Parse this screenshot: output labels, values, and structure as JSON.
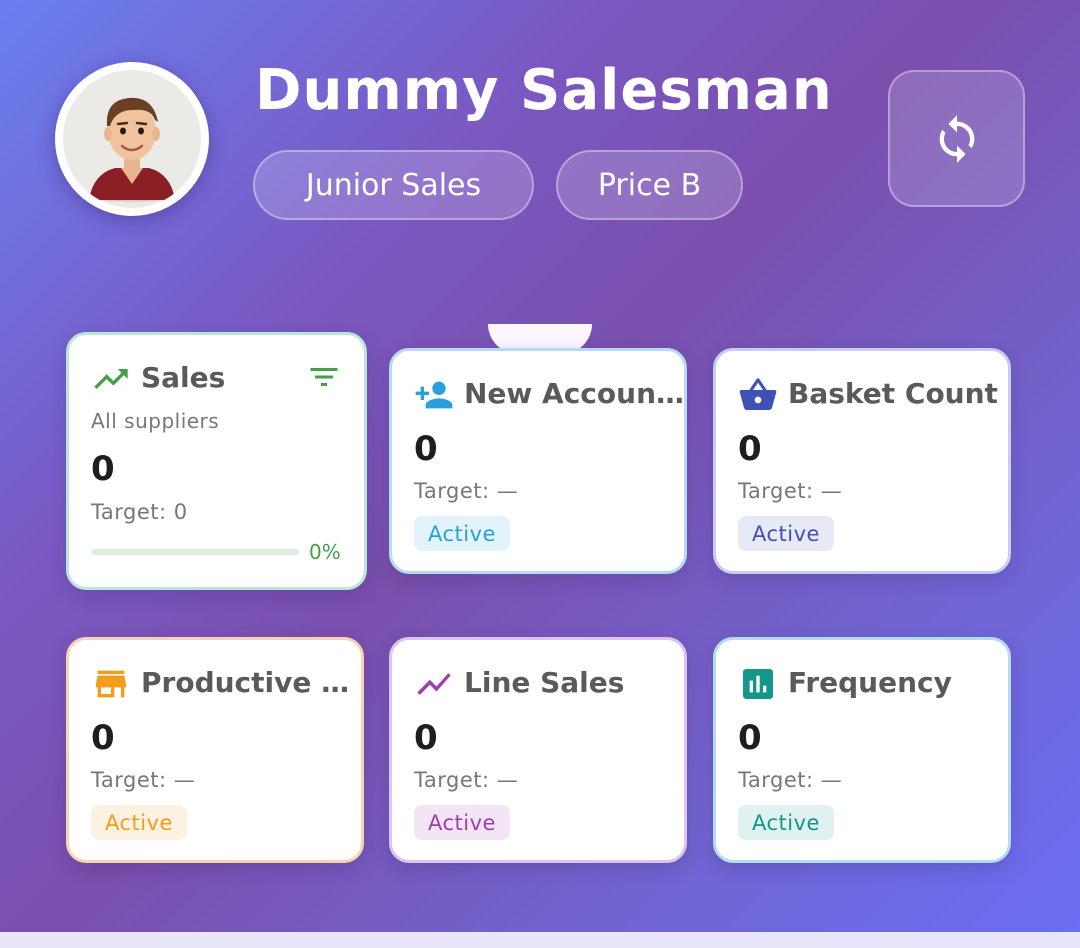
{
  "profile": {
    "name": "Dummy  Salesman",
    "role": "Junior Sales",
    "price_group": "Price B"
  },
  "header": {
    "refresh_icon": "refresh-icon"
  },
  "cards": [
    {
      "title": "Sales",
      "icon": "trending-up-icon",
      "subtitle": "All suppliers",
      "value": "0",
      "target": "Target: 0",
      "progress_label": "0%",
      "progress": 0,
      "accent": "#43a047"
    },
    {
      "title": "New Accoun…",
      "icon": "person-add-icon",
      "value": "0",
      "target": "Target: —",
      "status": "Active",
      "accent": "#29a0dc"
    },
    {
      "title": "Basket Count",
      "icon": "basket-icon",
      "value": "0",
      "target": "Target: —",
      "status": "Active",
      "accent": "#3f51b5"
    },
    {
      "title": "Productive …",
      "icon": "store-icon",
      "value": "0",
      "target": "Target: —",
      "status": "Active",
      "accent": "#f59c1a"
    },
    {
      "title": "Line Sales",
      "icon": "trend-line-icon",
      "value": "0",
      "target": "Target: —",
      "status": "Active",
      "accent": "#9c3fb0"
    },
    {
      "title": "Frequency",
      "icon": "bar-chart-icon",
      "value": "0",
      "target": "Target: —",
      "status": "Active",
      "accent": "#14968a"
    }
  ]
}
